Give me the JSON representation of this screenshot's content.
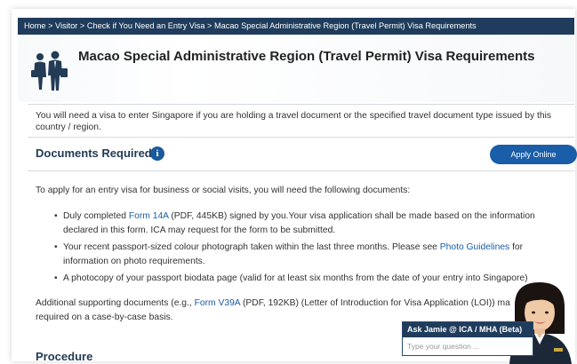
{
  "breadcrumb": {
    "items": [
      "Home",
      "Visitor",
      "Check if You Need an Entry Visa",
      "Macao Special Administrative Region (Travel Permit) Visa Requirements"
    ],
    "separator": " > "
  },
  "page": {
    "title": "Macao Special Administrative Region (Travel Permit) Visa Requirements",
    "icon": "travellers-icon",
    "intro": "You will need a visa to enter Singapore if you are holding a travel document or the specified travel document type issued by this country / region."
  },
  "documents": {
    "heading": "Documents Required",
    "info_icon": "i",
    "apply_label": "Apply Online",
    "lead": "To apply for an entry visa for business or social visits, you will need the following documents:",
    "bullets": [
      {
        "pre": "Duly completed ",
        "link": "Form 14A",
        "post": " (PDF, 445KB) signed by you.Your visa application shall be made based on the information declared in this form. ICA may request for the form to be submitted."
      },
      {
        "pre": "Your recent passport-sized colour photograph taken within the last three months. Please see ",
        "link": "Photo Guidelines",
        "post": " for information on photo requirements."
      },
      {
        "pre": "A photocopy of your passport biodata page (valid for at least six months from the date of your entry into Singapore)",
        "link": "",
        "post": ""
      }
    ],
    "additional": {
      "pre": "Additional supporting documents (e.g., ",
      "link": "Form V39A",
      "post": " (PDF, 192KB) (Letter of Introduction for Visa Application (LOI)) ma",
      "line2": "required on a case-by-case basis."
    }
  },
  "procedure": {
    "heading": "Procedure"
  },
  "chat": {
    "title": "Ask Jamie @ ICA / MHA (Beta)",
    "placeholder": "Type your question ..."
  },
  "colors": {
    "navy": "#1f3c5c",
    "link": "#1a5da8",
    "heading": "#233b55"
  }
}
